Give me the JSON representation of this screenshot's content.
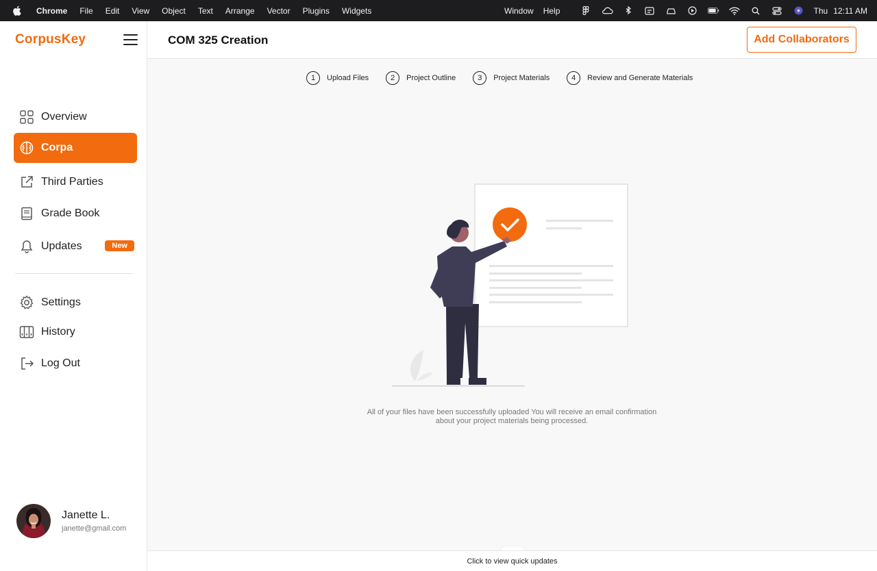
{
  "menubar": {
    "app_name": "Chrome",
    "items": [
      "File",
      "Edit",
      "View",
      "Object",
      "Text",
      "Arrange",
      "Vector",
      "Plugins",
      "Widgets"
    ],
    "right_items": [
      "Window",
      "Help"
    ],
    "day": "Thu",
    "time": "12:11 AM"
  },
  "sidebar": {
    "logo": "CorpusKey",
    "nav": [
      {
        "label": "Overview",
        "icon": "grid-icon"
      },
      {
        "label": "Corpa",
        "icon": "brain-icon",
        "active": true
      },
      {
        "label": "Third Parties",
        "icon": "external-link-icon"
      },
      {
        "label": "Grade Book",
        "icon": "book-icon"
      },
      {
        "label": "Updates",
        "icon": "bell-icon",
        "badge": "New"
      },
      {
        "label": "Settings",
        "icon": "gear-icon"
      },
      {
        "label": "History",
        "icon": "columns-icon"
      },
      {
        "label": "Log Out",
        "icon": "logout-icon"
      }
    ],
    "user": {
      "name": "Janette L.",
      "email": "janette@gmail.com"
    }
  },
  "header": {
    "title": "COM 325 Creation",
    "collab_button": "Add Collaborators"
  },
  "stepper": [
    {
      "num": "1",
      "label": "Upload Files"
    },
    {
      "num": "2",
      "label": "Project Outline"
    },
    {
      "num": "3",
      "label": "Project Materials"
    },
    {
      "num": "4",
      "label": "Review and Generate Materials"
    }
  ],
  "main": {
    "message_line1": "All of your files have been successfully uploaded You will receive an email confirmation",
    "message_line2": "about your project materials being processed."
  },
  "bottom_bar": {
    "label": "Click to view quick updates"
  },
  "colors": {
    "accent": "#f26b0f",
    "figure": "#3a3545",
    "skin": "#a0616a"
  }
}
